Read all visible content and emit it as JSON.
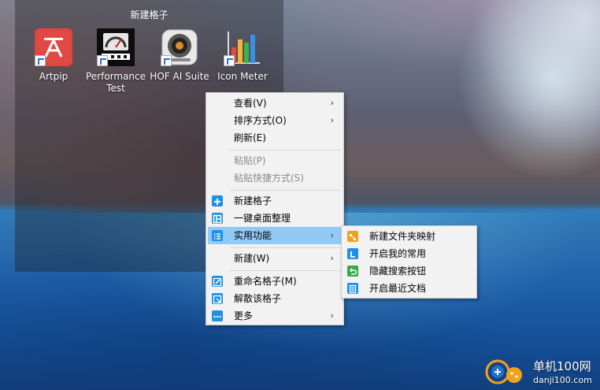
{
  "fence": {
    "title": "新建格子",
    "icons": [
      {
        "label": "Artpip",
        "icon": "artpip-icon"
      },
      {
        "label": "Performance Test",
        "icon": "performance-test-icon"
      },
      {
        "label": "HOF AI Suite",
        "icon": "hof-ai-suite-icon"
      },
      {
        "label": "Icon Meter",
        "icon": "icon-meter-icon"
      }
    ]
  },
  "context_menu": {
    "items": [
      {
        "label": "查看(V)",
        "has_submenu": true,
        "disabled": false
      },
      {
        "label": "排序方式(O)",
        "has_submenu": true,
        "disabled": false
      },
      {
        "label": "刷新(E)",
        "has_submenu": false,
        "disabled": false
      },
      {
        "label": "粘贴(P)",
        "has_submenu": false,
        "disabled": true
      },
      {
        "label": "粘贴快捷方式(S)",
        "has_submenu": false,
        "disabled": true
      },
      {
        "label": "新建格子",
        "icon": "plus-square-icon",
        "has_submenu": false,
        "disabled": false
      },
      {
        "label": "一键桌面整理",
        "icon": "layout-grid-icon",
        "has_submenu": false,
        "disabled": false
      },
      {
        "label": "实用功能",
        "icon": "list-icon",
        "has_submenu": true,
        "disabled": false,
        "highlighted": true
      },
      {
        "label": "新建(W)",
        "has_submenu": true,
        "disabled": false
      },
      {
        "label": "重命名格子(M)",
        "icon": "rename-edit-icon",
        "has_submenu": false,
        "disabled": false
      },
      {
        "label": "解散该格子",
        "icon": "dissolve-icon",
        "has_submenu": false,
        "disabled": false
      },
      {
        "label": "更多",
        "icon": "more-dots-icon",
        "has_submenu": true,
        "disabled": false
      }
    ]
  },
  "submenu": {
    "items": [
      {
        "label": "新建文件夹映射",
        "icon": "folder-map-icon"
      },
      {
        "label": "开启我的常用",
        "icon": "my-favorites-icon"
      },
      {
        "label": "隐藏搜索按钮",
        "icon": "hide-search-icon"
      },
      {
        "label": "开启最近文档",
        "icon": "recent-docs-icon"
      }
    ]
  },
  "watermark": {
    "name": "单机100网",
    "url": "danji100.com"
  },
  "colors": {
    "menu_bg": "#f2f2f2",
    "highlight": "#91c9f7",
    "icon_blue": "#1e90e6",
    "icon_orange": "#f0a020",
    "icon_green": "#3aa84a"
  }
}
